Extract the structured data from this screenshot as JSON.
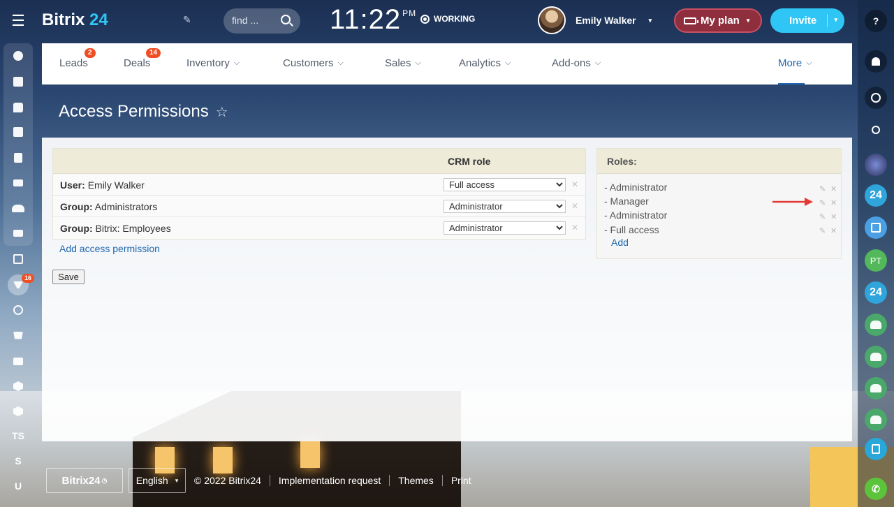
{
  "brand": {
    "name": "Bitrix",
    "number": "24"
  },
  "search": {
    "placeholder": "find ..."
  },
  "clock": {
    "time": "11:22",
    "ampm": "PM"
  },
  "status": {
    "label": "WORKING"
  },
  "user": {
    "name": "Emily Walker"
  },
  "buttons": {
    "my_plan": "My plan",
    "invite": "Invite"
  },
  "left_sidebar": {
    "badge_count": "16",
    "text_items": [
      "TS",
      "S",
      "U"
    ]
  },
  "nav": {
    "items": [
      {
        "label": "Leads",
        "badge": "2"
      },
      {
        "label": "Deals",
        "badge": "14"
      },
      {
        "label": "Inventory"
      },
      {
        "label": "Customers"
      },
      {
        "label": "Sales"
      },
      {
        "label": "Analytics"
      },
      {
        "label": "Add-ons"
      },
      {
        "label": "More"
      }
    ]
  },
  "page": {
    "title": "Access Permissions"
  },
  "permissions": {
    "header": "CRM role",
    "rows": [
      {
        "type": "User:",
        "name": "Emily Walker",
        "role": "Full access"
      },
      {
        "type": "Group:",
        "name": "Administrators",
        "role": "Administrator"
      },
      {
        "type": "Group:",
        "name": "Bitrix: Employees",
        "role": "Administrator"
      }
    ],
    "add_link": "Add access permission",
    "save_label": "Save"
  },
  "roles": {
    "header": "Roles:",
    "items": [
      "- Administrator",
      "- Manager",
      "- Administrator",
      "- Full access"
    ],
    "add_label": "Add"
  },
  "footer": {
    "logo": "Bitrix24",
    "language": "English",
    "copyright": "© 2022 Bitrix24",
    "links": [
      "Implementation request",
      "Themes",
      "Print"
    ]
  },
  "right_bar": {
    "b24_label": "24",
    "pt_initials": "PT"
  },
  "colors": {
    "accent": "#2fc6f6",
    "link": "#2067b0",
    "badge": "#f04e23",
    "plan": "#8f2f3e",
    "arrow": "#e53935"
  }
}
